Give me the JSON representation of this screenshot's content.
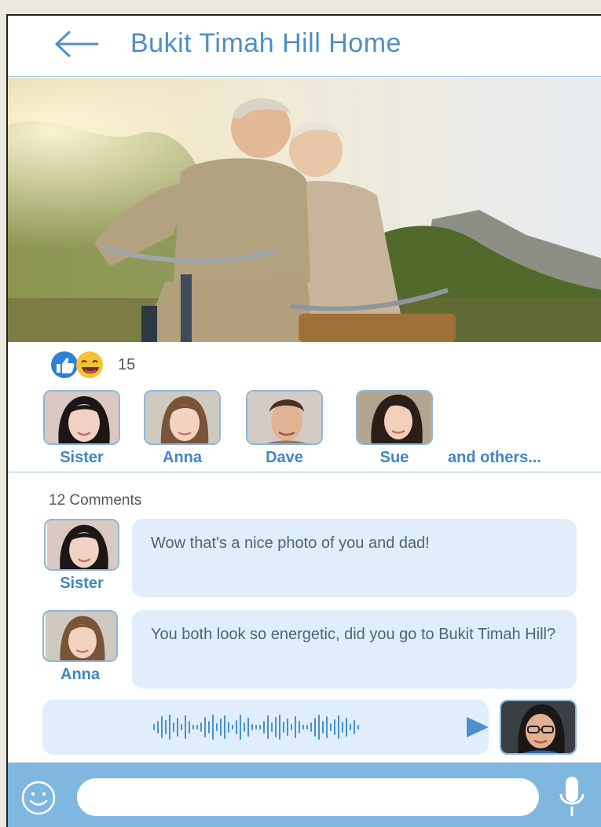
{
  "header": {
    "title": "Bukit Timah Hill Home",
    "back_icon": "arrow-left-icon"
  },
  "colors": {
    "accent": "#3f86c4",
    "title": "#4d8ec8",
    "bubble": "#dfeefa",
    "input_bar": "#7fb7e0"
  },
  "reactions": {
    "icons": [
      "thumbs-up-icon",
      "laughing-face-icon"
    ],
    "count": "15"
  },
  "likers": [
    {
      "name": "Sister"
    },
    {
      "name": "Anna"
    },
    {
      "name": "Dave"
    },
    {
      "name": "Sue"
    }
  ],
  "likers_more": "and others...",
  "comments_header": "12 Comments",
  "comments": [
    {
      "author": "Sister",
      "text": "Wow that's a nice photo of you and dad!"
    },
    {
      "author": "Anna",
      "text": "You both look so energetic, did you go to Bukit Timah Hill?"
    }
  ],
  "voice_message": {
    "icon": "play-icon"
  },
  "composer": {
    "placeholder": "",
    "emoji_icon": "smiley-icon",
    "mic_icon": "microphone-icon"
  }
}
